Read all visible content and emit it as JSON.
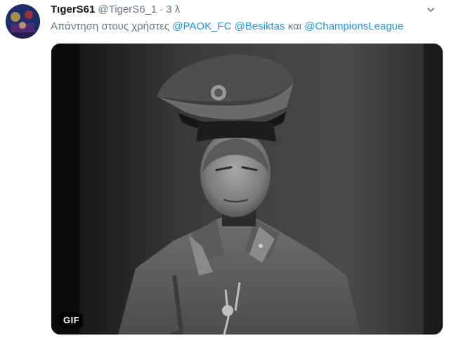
{
  "tweet": {
    "display_name": "TιgerS61",
    "handle": "@TigerS6_1",
    "separator": "·",
    "time": "3 λ",
    "reply_prefix": "Απάντηση στους χρήστες",
    "mentions": [
      "@PAOK_FC",
      "@Besiktas"
    ],
    "conjunction": "και",
    "last_mention": "@ChampionsLeague",
    "media_badge": "GIF"
  },
  "icons": {
    "caret": "chevron-down-icon",
    "avatar": "avatar"
  },
  "colors": {
    "link": "#1b95e0",
    "secondary_text": "#657786",
    "primary_text": "#14171a"
  }
}
